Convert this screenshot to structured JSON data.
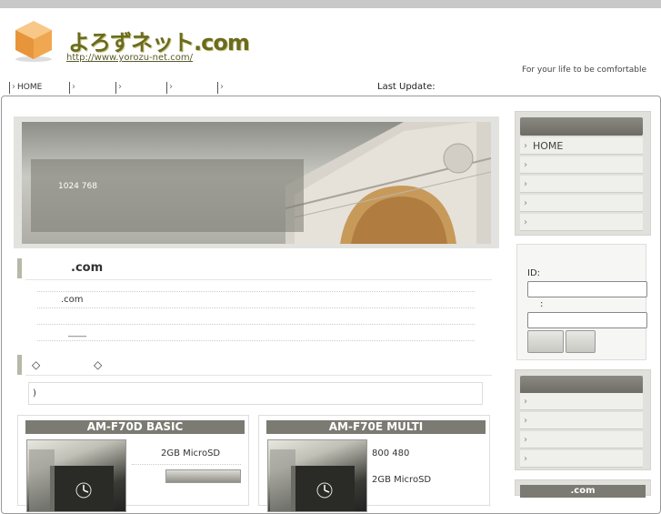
{
  "header": {
    "logo_text": "よろずネット.com",
    "url": "http://www.yorozu-net.com/",
    "tagline": "For your life to be comfortable"
  },
  "topnav": {
    "items": [
      "HOME",
      "",
      "",
      "",
      ""
    ],
    "last_update_label": "Last Update:"
  },
  "hero": {
    "caption": "1024 768"
  },
  "main": {
    "section1_title": ".com",
    "line1": ".com",
    "line3_link": "____",
    "section2_item1": "◇",
    "section2_item2": "◇",
    "notice_text": ")"
  },
  "products": [
    {
      "title": "AM-F70D BASIC",
      "spec1": "2GB MicroSD",
      "spec2": ""
    },
    {
      "title": "AM-F70E MULTI",
      "spec1": "800 480",
      "spec2": "2GB MicroSD"
    }
  ],
  "sidebar": {
    "menu_items": [
      "HOME",
      "",
      "",
      "",
      ""
    ],
    "login": {
      "id_label": "ID:",
      "pw_label": ":",
      "id_value": "",
      "pw_value": ""
    },
    "menu2_items": [
      "",
      "",
      "",
      ""
    ],
    "bottom_tab": ".com"
  },
  "colors": {
    "accent_olive": "#6b6b1e",
    "header_gray": "#7b7b73",
    "sidebar_bg": "#e0e0dc"
  }
}
